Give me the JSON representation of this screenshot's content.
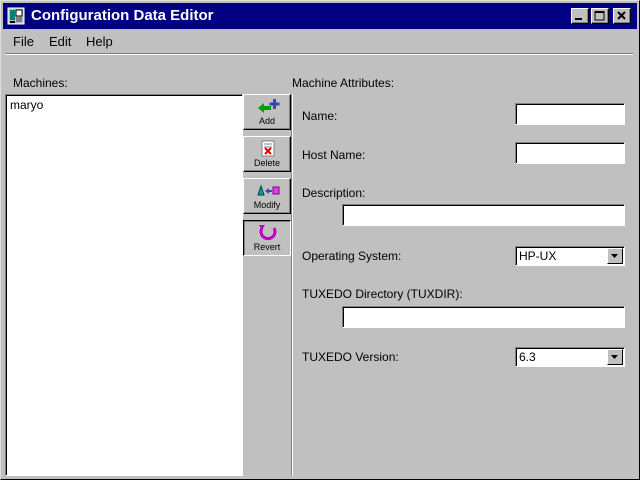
{
  "window": {
    "title": "Configuration Data Editor"
  },
  "menu": {
    "file": "File",
    "edit": "Edit",
    "help": "Help"
  },
  "machines": {
    "label": "Machines:",
    "items": [
      "maryo"
    ]
  },
  "toolbar": {
    "add": "Add",
    "delete": "Delete",
    "modify": "Modify",
    "revert": "Revert"
  },
  "attributes": {
    "label": "Machine Attributes:",
    "name_label": "Name:",
    "name_value": "",
    "host_label": "Host Name:",
    "host_value": "",
    "desc_label": "Description:",
    "desc_value": "",
    "os_label": "Operating System:",
    "os_value": "HP-UX",
    "tuxdir_label": "TUXEDO Directory (TUXDIR):",
    "tuxdir_value": "",
    "version_label": "TUXEDO Version:",
    "version_value": "6.3"
  },
  "colors": {
    "titlebar": "#000080",
    "face": "#c0c0c0",
    "revert_icon": "#c000c0"
  }
}
